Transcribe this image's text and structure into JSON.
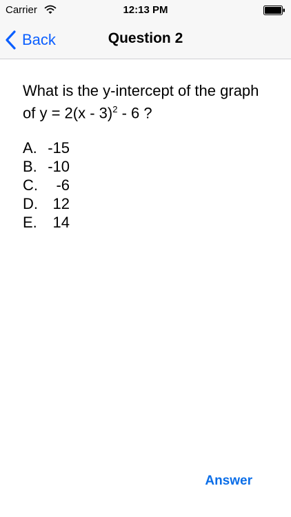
{
  "status_bar": {
    "carrier": "Carrier",
    "time": "12:13 PM",
    "icons": [
      "wifi-icon",
      "battery-icon"
    ]
  },
  "nav": {
    "back_label": "Back",
    "title": "Question 2",
    "icons": [
      "chevron-left-icon"
    ],
    "accent_color": "#0b5fff"
  },
  "question": {
    "text_before_sup": "What is the y-intercept of the graph of y = 2(x - 3)",
    "superscript": "2",
    "text_after_sup": " - 6 ?",
    "choices": [
      {
        "letter": "A.",
        "value": "-15"
      },
      {
        "letter": "B.",
        "value": "-10"
      },
      {
        "letter": "C.",
        "value": "-6"
      },
      {
        "letter": "D.",
        "value": "12"
      },
      {
        "letter": "E.",
        "value": "14"
      }
    ]
  },
  "footer": {
    "answer_label": "Answer",
    "answer_color": "#0b6ee8"
  }
}
